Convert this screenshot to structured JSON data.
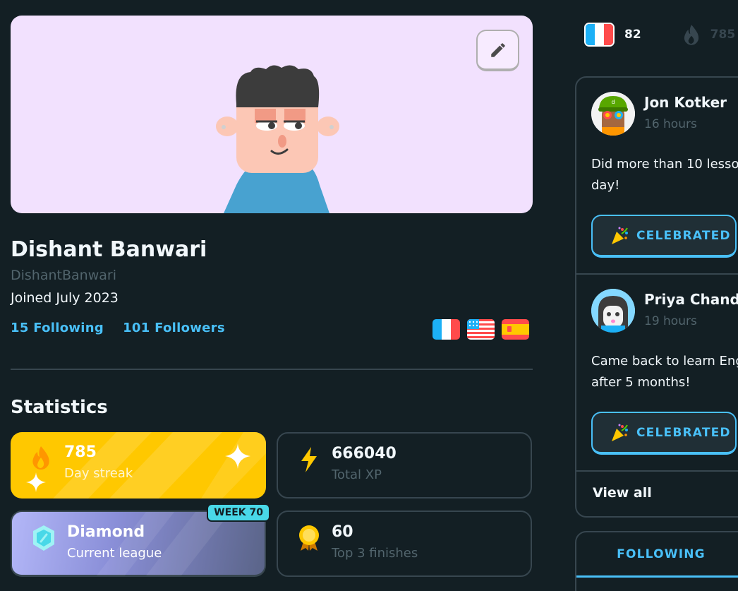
{
  "profile": {
    "display_name": "Dishant Banwari",
    "username": "DishantBanwari",
    "joined": "Joined July 2023",
    "following": "15 Following",
    "followers": "101 Followers",
    "languages": [
      "French",
      "English",
      "Spanish"
    ]
  },
  "statistics": {
    "title": "Statistics",
    "streak": {
      "value": "785",
      "label": "Day streak"
    },
    "xp": {
      "value": "666040",
      "label": "Total XP"
    },
    "league": {
      "value": "Diamond",
      "label": "Current league",
      "badge": "WEEK 70"
    },
    "top3": {
      "value": "60",
      "label": "Top 3 finishes"
    }
  },
  "topbar": {
    "course_count": "82",
    "streak_count": "785"
  },
  "feed": {
    "items": [
      {
        "name": "Jon Kotker",
        "time": "16 hours",
        "text_line1": "Did more than 10 lesso",
        "text_line2": "day!",
        "button": "CELEBRATED"
      },
      {
        "name": "Priya Chand",
        "time": "19 hours",
        "text_line1": "Came back to learn Eng",
        "text_line2": "after 5 months!",
        "button": "CELEBRATED"
      }
    ],
    "view_all": "View all"
  },
  "tabs": {
    "following": "FOLLOWING"
  },
  "colors": {
    "background": "#131f24",
    "accent_blue": "#49c0f8",
    "streak_gold": "#ffc800",
    "border": "#37464f",
    "muted": "#52656d"
  },
  "icons": [
    "pencil-icon",
    "fire-icon",
    "sparkle-icon",
    "lightning-icon",
    "gem-icon",
    "medal-icon",
    "party-popper-icon",
    "flag-france-icon",
    "flag-usa-icon",
    "flag-spain-icon"
  ]
}
